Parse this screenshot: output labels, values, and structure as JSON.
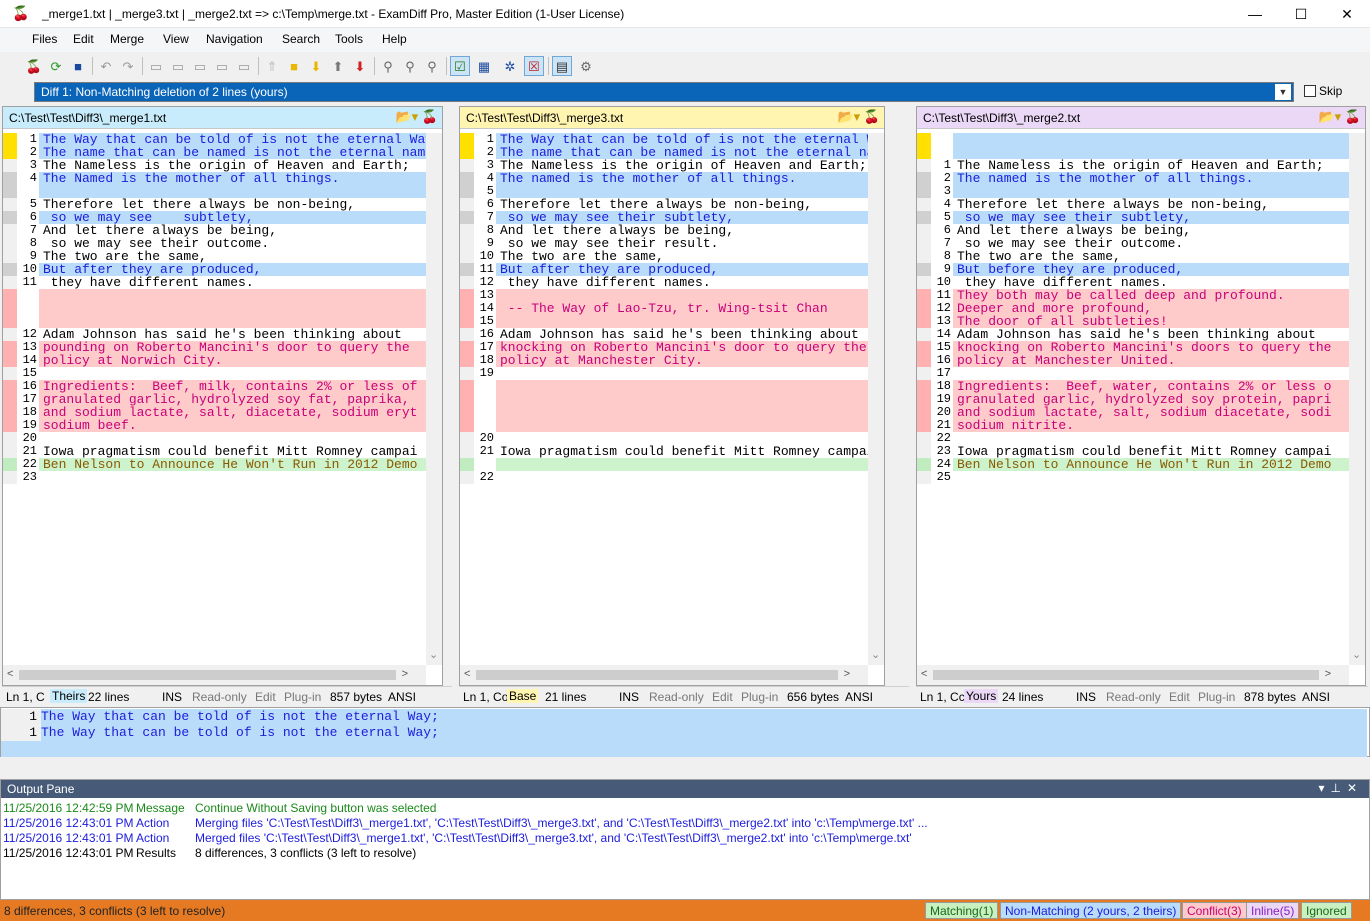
{
  "window": {
    "title": "_merge1.txt  |  _merge3.txt  |  _merge2.txt  =>  c:\\Temp\\merge.txt - ExamDiff Pro, Master Edition (1-User License)",
    "minimize": "—",
    "maximize": "☐",
    "close": "✕"
  },
  "menu": [
    "Files",
    "Edit",
    "Merge",
    "View",
    "Navigation",
    "Search",
    "Tools",
    "Help"
  ],
  "toolbar_icons": [
    "open-icon",
    "refresh-icon",
    "save-icon",
    "undo-icon",
    "redo-icon",
    "copy-left-icon",
    "copy-middle-icon",
    "copy-right-icon",
    "copy-all-icon",
    "first-diff-icon",
    "current-diff-icon",
    "next-diff-icon",
    "prev-diff-icon",
    "last-diff-icon",
    "find-icon",
    "find-next-icon",
    "find-prev-icon",
    "show-diffs-icon",
    "view-options-icon",
    "plugins-icon",
    "compare-options-icon",
    "report-icon",
    "settings-icon"
  ],
  "diff_nav": {
    "current": "Diff 1: Non-Matching deletion of 2 lines (yours)",
    "skip_label": "Skip"
  },
  "panes": [
    {
      "path": "C:\\Test\\Test\\Diff3\\_merge1.txt",
      "header_color": "#c8ecfb",
      "status": {
        "pos": "Ln 1, C",
        "role": "Theirs",
        "role_color": "#c8ecfb",
        "lines": "22 lines",
        "ins": "INS",
        "ro": "Read-only",
        "edit": "Edit",
        "plugin": "Plug-in",
        "bytes": "857 bytes",
        "enc": "ANSI"
      },
      "rows": [
        {
          "n": "1",
          "t": "The Way that can be told of is not the eternal Way;",
          "c": "blue",
          "g": "#ffe000"
        },
        {
          "n": "2",
          "t": "The name that can be named is not the eternal name.",
          "c": "blue",
          "g": "#ffe000"
        },
        {
          "n": "3",
          "t": "The Nameless is the origin of Heaven and Earth;",
          "c": "",
          "g": ""
        },
        {
          "n": "4",
          "t": "The Named is the mother of all things.",
          "c": "blue",
          "g": "#d0d0d0"
        },
        {
          "n": "",
          "t": "",
          "c": "blue",
          "g": "#d0d0d0"
        },
        {
          "n": "5",
          "t": "Therefore let there always be non-being,",
          "c": "",
          "g": ""
        },
        {
          "n": "6",
          "t": " so we may see    subtlety,",
          "c": "blue",
          "g": "#d0d0d0"
        },
        {
          "n": "7",
          "t": "And let there always be being,",
          "c": "",
          "g": ""
        },
        {
          "n": "8",
          "t": " so we may see their outcome.",
          "c": "",
          "g": ""
        },
        {
          "n": "9",
          "t": "The two are the same,",
          "c": "",
          "g": ""
        },
        {
          "n": "10",
          "t": "But after they are produced,",
          "c": "blue",
          "g": "#d0d0d0"
        },
        {
          "n": "11",
          "t": " they have different names.",
          "c": "",
          "g": ""
        },
        {
          "n": "",
          "t": "",
          "c": "red",
          "g": "#ffb0b0"
        },
        {
          "n": "",
          "t": "",
          "c": "red",
          "g": "#ffb0b0"
        },
        {
          "n": "",
          "t": "",
          "c": "red",
          "g": "#ffb0b0"
        },
        {
          "n": "12",
          "t": "Adam Johnson has said he's been thinking about",
          "c": "",
          "g": ""
        },
        {
          "n": "13",
          "t": "pounding on Roberto Mancini's door to query the",
          "c": "red",
          "g": "#ffb0b0"
        },
        {
          "n": "14",
          "t": "policy at Norwich City.",
          "c": "red",
          "g": "#ffb0b0"
        },
        {
          "n": "15",
          "t": "",
          "c": "",
          "g": ""
        },
        {
          "n": "16",
          "t": "Ingredients:  Beef, milk, contains 2% or less of",
          "c": "red",
          "g": "#ffb0b0"
        },
        {
          "n": "17",
          "t": "granulated garlic, hydrolyzed soy fat, paprika,",
          "c": "red",
          "g": "#ffb0b0"
        },
        {
          "n": "18",
          "t": "and sodium lactate, salt, diacetate, sodium eryt",
          "c": "red",
          "g": "#ffb0b0"
        },
        {
          "n": "19",
          "t": "sodium beef.",
          "c": "red",
          "g": "#ffb0b0"
        },
        {
          "n": "20",
          "t": "",
          "c": "",
          "g": ""
        },
        {
          "n": "21",
          "t": "Iowa pragmatism could benefit Mitt Romney campai",
          "c": "",
          "g": ""
        },
        {
          "n": "22",
          "t": "Ben Nelson to Announce He Won't Run in 2012 Demo",
          "c": "green",
          "g": "#c0ecc0"
        },
        {
          "n": "23",
          "t": "",
          "c": "",
          "g": ""
        }
      ]
    },
    {
      "path": "C:\\Test\\Test\\Diff3\\_merge3.txt",
      "header_color": "#fff4b0",
      "status": {
        "pos": "Ln 1, Col",
        "role": "Base",
        "role_color": "#fff4b0",
        "lines": "21 lines",
        "ins": "INS",
        "ro": "Read-only",
        "edit": "Edit",
        "plugin": "Plug-in",
        "bytes": "656 bytes",
        "enc": "ANSI"
      },
      "rows": [
        {
          "n": "1",
          "t": "The Way that can be told of is not the eternal Way;",
          "c": "blue",
          "g": "#ffe000"
        },
        {
          "n": "2",
          "t": "The name that can be named is not the eternal name.",
          "c": "blue",
          "g": "#ffe000"
        },
        {
          "n": "3",
          "t": "The Nameless is the origin of Heaven and Earth;",
          "c": "",
          "g": ""
        },
        {
          "n": "4",
          "t": "The named is the mother of all things.",
          "c": "blue",
          "g": "#d0d0d0"
        },
        {
          "n": "5",
          "t": "",
          "c": "blue",
          "g": "#d0d0d0"
        },
        {
          "n": "6",
          "t": "Therefore let there always be non-being,",
          "c": "",
          "g": ""
        },
        {
          "n": "7",
          "t": " so we may see their subtlety,",
          "c": "blue",
          "g": "#d0d0d0"
        },
        {
          "n": "8",
          "t": "And let there always be being,",
          "c": "",
          "g": ""
        },
        {
          "n": "9",
          "t": " so we may see their result.",
          "c": "",
          "g": ""
        },
        {
          "n": "10",
          "t": "The two are the same,",
          "c": "",
          "g": ""
        },
        {
          "n": "11",
          "t": "But after they are produced,",
          "c": "blue",
          "g": "#d0d0d0"
        },
        {
          "n": "12",
          "t": " they have different names.",
          "c": "",
          "g": ""
        },
        {
          "n": "13",
          "t": "",
          "c": "red",
          "g": "#ffb0b0"
        },
        {
          "n": "14",
          "t": " -- The Way of Lao-Tzu, tr. Wing-tsit Chan",
          "c": "red",
          "g": "#ffb0b0"
        },
        {
          "n": "15",
          "t": "",
          "c": "red",
          "g": "#ffb0b0"
        },
        {
          "n": "16",
          "t": "Adam Johnson has said he's been thinking about",
          "c": "",
          "g": ""
        },
        {
          "n": "17",
          "t": "knocking on Roberto Mancini's door to query the",
          "c": "red",
          "g": "#ffb0b0"
        },
        {
          "n": "18",
          "t": "policy at Manchester City.",
          "c": "red",
          "g": "#ffb0b0"
        },
        {
          "n": "19",
          "t": "",
          "c": "",
          "g": ""
        },
        {
          "n": "",
          "t": "",
          "c": "red",
          "g": "#ffb0b0"
        },
        {
          "n": "",
          "t": "",
          "c": "red",
          "g": "#ffb0b0"
        },
        {
          "n": "",
          "t": "",
          "c": "red",
          "g": "#ffb0b0"
        },
        {
          "n": "",
          "t": "",
          "c": "red",
          "g": "#ffb0b0"
        },
        {
          "n": "20",
          "t": "",
          "c": "",
          "g": ""
        },
        {
          "n": "21",
          "t": "Iowa pragmatism could benefit Mitt Romney campai",
          "c": "",
          "g": ""
        },
        {
          "n": "",
          "t": "",
          "c": "green",
          "g": "#c0ecc0"
        },
        {
          "n": "22",
          "t": "",
          "c": "",
          "g": ""
        }
      ]
    },
    {
      "path": "C:\\Test\\Test\\Diff3\\_merge2.txt",
      "header_color": "#ead8f6",
      "status": {
        "pos": "Ln 1, Cc",
        "role": "Yours",
        "role_color": "#ead8f6",
        "lines": "24 lines",
        "ins": "INS",
        "ro": "Read-only",
        "edit": "Edit",
        "plugin": "Plug-in",
        "bytes": "878 bytes",
        "enc": "ANSI"
      },
      "rows": [
        {
          "n": "",
          "t": "",
          "c": "blue",
          "g": "#ffe000"
        },
        {
          "n": "",
          "t": "",
          "c": "blue",
          "g": "#ffe000"
        },
        {
          "n": "1",
          "t": "The Nameless is the origin of Heaven and Earth;",
          "c": "",
          "g": ""
        },
        {
          "n": "2",
          "t": "The named is the mother of all things.",
          "c": "blue",
          "g": "#d0d0d0"
        },
        {
          "n": "3",
          "t": "",
          "c": "blue",
          "g": "#d0d0d0"
        },
        {
          "n": "4",
          "t": "Therefore let there always be non-being,",
          "c": "",
          "g": ""
        },
        {
          "n": "5",
          "t": " so we may see their subtlety,",
          "c": "blue",
          "g": "#d0d0d0"
        },
        {
          "n": "6",
          "t": "And let there always be being,",
          "c": "",
          "g": ""
        },
        {
          "n": "7",
          "t": " so we may see their outcome.",
          "c": "",
          "g": ""
        },
        {
          "n": "8",
          "t": "The two are the same,",
          "c": "",
          "g": ""
        },
        {
          "n": "9",
          "t": "But before they are produced,",
          "c": "blue",
          "g": "#d0d0d0"
        },
        {
          "n": "10",
          "t": " they have different names.",
          "c": "",
          "g": ""
        },
        {
          "n": "11",
          "t": "They both may be called deep and profound.",
          "c": "red",
          "g": "#ffb0b0"
        },
        {
          "n": "12",
          "t": "Deeper and more profound,",
          "c": "red",
          "g": "#ffb0b0"
        },
        {
          "n": "13",
          "t": "The door of all subtleties!",
          "c": "red",
          "g": "#ffb0b0"
        },
        {
          "n": "14",
          "t": "Adam Johnson has said he's been thinking about",
          "c": "",
          "g": ""
        },
        {
          "n": "15",
          "t": "knocking on Roberto Mancini's doors to query the",
          "c": "red",
          "g": "#ffb0b0"
        },
        {
          "n": "16",
          "t": "policy at Manchester United.",
          "c": "red",
          "g": "#ffb0b0"
        },
        {
          "n": "17",
          "t": "",
          "c": "",
          "g": ""
        },
        {
          "n": "18",
          "t": "Ingredients:  Beef, water, contains 2% or less o",
          "c": "red",
          "g": "#ffb0b0"
        },
        {
          "n": "19",
          "t": "granulated garlic, hydrolyzed soy protein, papri",
          "c": "red",
          "g": "#ffb0b0"
        },
        {
          "n": "20",
          "t": "and sodium lactate, salt, sodium diacetate, sodi",
          "c": "red",
          "g": "#ffb0b0"
        },
        {
          "n": "21",
          "t": "sodium nitrite.",
          "c": "red",
          "g": "#ffb0b0"
        },
        {
          "n": "22",
          "t": "",
          "c": "",
          "g": ""
        },
        {
          "n": "23",
          "t": "Iowa pragmatism could benefit Mitt Romney campai",
          "c": "",
          "g": ""
        },
        {
          "n": "24",
          "t": "Ben Nelson to Announce He Won't Run in 2012 Demo",
          "c": "green",
          "g": "#c0ecc0"
        },
        {
          "n": "25",
          "t": "",
          "c": "",
          "g": ""
        }
      ]
    }
  ],
  "line_compare": [
    {
      "n": "1",
      "t": "The Way that can be told of is not the eternal Way;"
    },
    {
      "n": "1",
      "t": "The Way that can be told of is not the eternal Way;"
    }
  ],
  "output_pane": {
    "title": "Output Pane",
    "rows": [
      {
        "time": "11/25/2016 12:42:59 PM",
        "type": "Message",
        "text": "Continue Without Saving button was selected",
        "color": "#1a8a1a"
      },
      {
        "time": "11/25/2016 12:43:01 PM",
        "type": "Action",
        "text": "Merging files 'C:\\Test\\Test\\Diff3\\_merge1.txt', 'C:\\Test\\Test\\Diff3\\_merge3.txt', and 'C:\\Test\\Test\\Diff3\\_merge2.txt' into 'c:\\Temp\\merge.txt' ...",
        "color": "#1c1cdc"
      },
      {
        "time": "11/25/2016 12:43:01 PM",
        "type": "Action",
        "text": "Merged files 'C:\\Test\\Test\\Diff3\\_merge1.txt', 'C:\\Test\\Test\\Diff3\\_merge3.txt', and 'C:\\Test\\Test\\Diff3\\_merge2.txt' into 'c:\\Temp\\merge.txt'",
        "color": "#1c1cdc"
      },
      {
        "time": "11/25/2016 12:43:01 PM",
        "type": "Results",
        "text": "8 differences, 3 conflicts (3 left to resolve)",
        "color": "#000000"
      }
    ]
  },
  "statusbar": {
    "summary": "8 differences, 3 conflicts (3 left to resolve)",
    "badges": [
      {
        "label": "Matching(1)",
        "bg": "#c8f0c0",
        "color": "#1a6a1a"
      },
      {
        "label": "Non-Matching (2 yours, 2 theirs)",
        "bg": "#b9dcfa",
        "color": "#1c1cdc"
      },
      {
        "label": "Conflict(3)",
        "bg": "#ffcaca",
        "color": "#c8007a"
      },
      {
        "label": "Inline(5)",
        "bg": "#ead8f6",
        "color": "#8a20c0"
      },
      {
        "label": "Ignored",
        "bg": "#c8f0c0",
        "color": "#1a6a1a"
      }
    ]
  },
  "colors": {
    "accent": "#0a64b8",
    "status_orange": "#e67a23",
    "output_header": "#475b78"
  }
}
